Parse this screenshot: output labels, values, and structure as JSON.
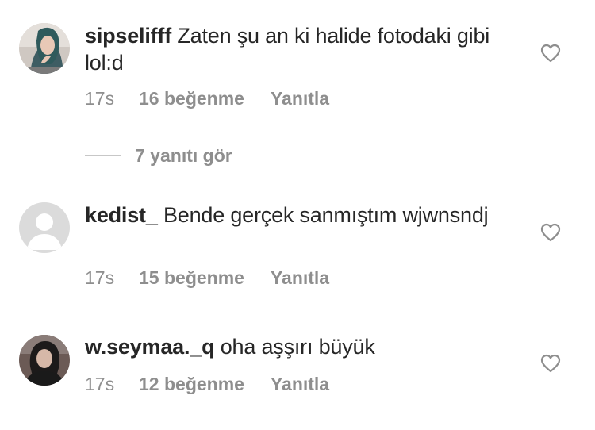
{
  "comments": [
    {
      "username": "sipselifff",
      "text": "Zaten şu an ki halide fotodaki gibi lol:d",
      "time": "17s",
      "likes": "16 beğenme",
      "reply": "Yanıtla",
      "avatar": "profile-photo-hijab"
    },
    {
      "username": "kedist_",
      "text": "Bende gerçek sanmıştım wjwnsndj",
      "time": "17s",
      "likes": "15 beğenme",
      "reply": "Yanıtla",
      "avatar": "default-profile-placeholder"
    },
    {
      "username": "w.seymaa._q",
      "text": "oha aşşırı büyük",
      "time": "17s",
      "likes": "12 beğenme",
      "reply": "Yanıtla",
      "avatar": "profile-photo-dark"
    }
  ],
  "view_replies": "7 yanıtı gör",
  "icons": {
    "like": "heart-outline-icon"
  },
  "colors": {
    "text": "#262626",
    "secondary": "#8e8e8e",
    "placeholder_avatar": "#dbdbdb"
  }
}
